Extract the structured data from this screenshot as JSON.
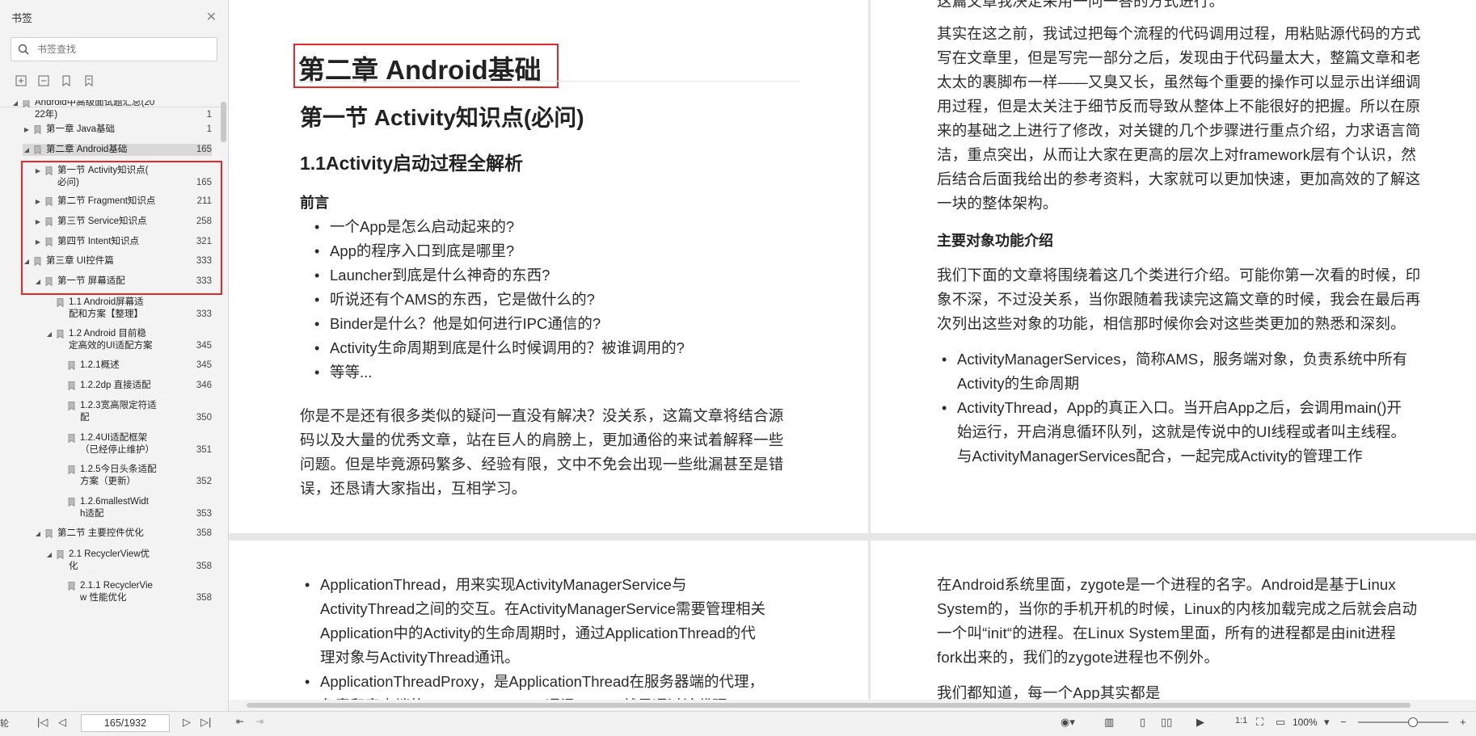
{
  "sidebar": {
    "title": "书签",
    "search_placeholder": "书签查找",
    "tree": [
      {
        "label": "Android中高级面试题汇总(20\n22年)",
        "page": "1",
        "expanded": true
      },
      {
        "label": "第一章 Java基础",
        "page": "1",
        "expanded": false
      },
      {
        "label": "第二章 Android基础",
        "page": "165",
        "expanded": true,
        "selected": true
      },
      {
        "label": "第一节 Activity知识点(\n必问)",
        "page": "165",
        "expanded": false
      },
      {
        "label": "第二节 Fragment知识点",
        "page": "211",
        "expanded": false
      },
      {
        "label": "第三节 Service知识点",
        "page": "258",
        "expanded": false
      },
      {
        "label": "第四节 Intent知识点",
        "page": "321",
        "expanded": false
      },
      {
        "label": "第三章 UI控件篇",
        "page": "333",
        "expanded": true
      },
      {
        "label": "第一节 屏幕适配",
        "page": "333",
        "expanded": true
      },
      {
        "label": "1.1 Android屏幕适\n配和方案【整理】",
        "page": "333"
      },
      {
        "label": "1.2 Android 目前稳\n定高效的UI适配方案",
        "page": "345",
        "expanded": true
      },
      {
        "label": "1.2.1概述",
        "page": "345"
      },
      {
        "label": "1.2.2dp 直接适配",
        "page": "346"
      },
      {
        "label": "1.2.3宽高限定符适\n配",
        "page": "350"
      },
      {
        "label": "1.2.4UI适配框架\n（已经停止维护）",
        "page": "351"
      },
      {
        "label": "1.2.5今日头条适配\n方案（更新）",
        "page": "352"
      },
      {
        "label": "1.2.6mallestWidt\nh适配",
        "page": "353"
      },
      {
        "label": "第二节 主要控件优化",
        "page": "358",
        "expanded": true
      },
      {
        "label": "2.1 RecyclerView优\n化",
        "page": "358",
        "expanded": true
      },
      {
        "label": "2.1.1 RecyclerVie\nw 性能优化",
        "page": "358"
      }
    ]
  },
  "page1": {
    "chapter_title": "第二章 Android基础",
    "section_title": "第一节 Activity知识点(必问)",
    "subsection_title": "1.1Activity启动过程全解析",
    "preface_heading": "前言",
    "bullets": [
      "一个App是怎么启动起来的?",
      "App的程序入口到底是哪里?",
      "Launcher到底是什么神奇的东西?",
      "听说还有个AMS的东西，它是做什么的?",
      "Binder是什么？他是如何进行IPC通信的?",
      "Activity生命周期到底是什么时候调用的？被谁调用的?",
      "等等..."
    ],
    "paragraph": "你是不是还有很多类似的疑问一直没有解决？没关系，这篇文章将结合源\n码以及大量的优秀文章，站在巨人的肩膀上，更加通俗的来试着解释一些\n问题。但是毕竟源码繁多、经验有限，文中不免会出现一些纰漏甚至是错\n误，还恳请大家指出，互相学习。"
  },
  "page2": {
    "top_cut": "这篇文章我决定采用一问一答的方式进行。",
    "para1": "其实在这之前，我试过把每个流程的代码调用过程，用粘贴源代码的方式\n写在文章里，但是写完一部分之后，发现由于代码量太大，整篇文章和老\n太太的裹脚布一样——又臭又长，虽然每个重要的操作可以显示出详细调\n用过程，但是太关注于细节反而导致从整体上不能很好的把握。所以在原\n来的基础之上进行了修改，对关键的几个步骤进行重点介绍，力求语言简\n洁，重点突出，从而让大家在更高的层次上对framework层有个认识，然\n后结合后面我给出的参考资料，大家就可以更加快速，更加高效的了解这\n一块的整体架构。",
    "heading": "主要对象功能介绍",
    "para2": "我们下面的文章将围绕着这几个类进行介绍。可能你第一次看的时候，印\n象不深，不过没关系，当你跟随着我读完这篇文章的时候，我会在最后再\n次列出这些对象的功能，相信那时候你会对这些类更加的熟悉和深刻。",
    "bullets": [
      "ActivityManagerServices，简称AMS，服务端对象，负责系统中所有\nActivity的生命周期",
      "ActivityThread，App的真正入口。当开启App之后，会调用main()开\n始运行，开启消息循环队列，这就是传说中的UI线程或者叫主线程。\n与ActivityManagerServices配合，一起完成Activity的管理工作"
    ]
  },
  "page3": {
    "bullets": [
      "ApplicationThread，用来实现ActivityManagerService与\nActivityThread之间的交互。在ActivityManagerService需要管理相关\nApplication中的Activity的生命周期时，通过ApplicationThread的代\n理对象与ActivityThread通讯。",
      "ApplicationThreadProxy，是ApplicationThread在服务器端的代理，\n负责和客户端的ApplicationThread通讯。AMS就是通过该代理"
    ]
  },
  "page4": {
    "para1": "在Android系统里面，zygote是一个进程的名字。Android是基于Linux\nSystem的，当你的手机开机的时候，Linux的内核加载完成之后就会启动\n一个叫“init“的进程。在Linux System里面，所有的进程都是由init进程\nfork出来的，我们的zygote进程也不例外。",
    "para2": "我们都知道，每一个App其实都是"
  },
  "statusbar": {
    "left_cut": "轮",
    "page_indicator": "165/1932",
    "zoom": "100%"
  }
}
